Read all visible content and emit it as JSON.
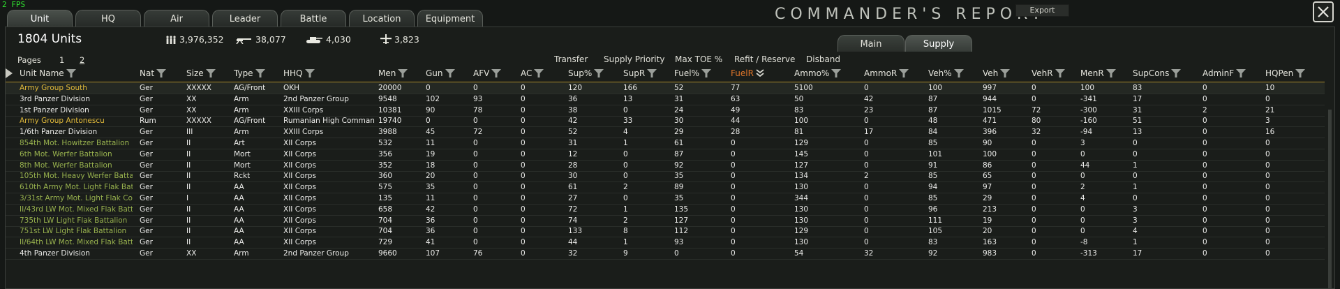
{
  "fps": "2 FPS",
  "tabs": [
    "Unit",
    "HQ",
    "Air",
    "Leader",
    "Battle",
    "Location",
    "Equipment"
  ],
  "title": "COMMANDER'S REPORT",
  "export_label": "Export",
  "units_count": "1804 Units",
  "stats": {
    "men": "3,976,352",
    "guns": "38,077",
    "afv": "4,030",
    "aircraft": "3,823"
  },
  "subtabs": [
    "Main",
    "Supply"
  ],
  "actions": [
    "Transfer",
    "Supply Priority",
    "Max TOE %",
    "Refit / Reserve",
    "Disband"
  ],
  "pages": {
    "label": "Pages",
    "items": [
      "1",
      "2"
    ],
    "current": "2"
  },
  "columns": [
    "Unit Name",
    "Nat",
    "Size",
    "Type",
    "HHQ",
    "Men",
    "Gun",
    "AFV",
    "AC",
    "Sup%",
    "SupR",
    "Fuel%",
    "FuelR",
    "Ammo%",
    "AmmoR",
    "Veh%",
    "Veh",
    "VehR",
    "MenR",
    "SupCons",
    "AdminF",
    "HQPen"
  ],
  "sorted_column": "FuelR",
  "colors": {
    "hq_unit": "#e0b93a",
    "division": "#ececea",
    "support_unit": "#98b24e",
    "accent": "#a88a2a",
    "sorted_header": "#e0762a"
  },
  "rows": [
    {
      "kind": "hq",
      "cells": [
        "Army Group South",
        "Ger",
        "XXXXX",
        "AG/Front",
        "OKH",
        "20000",
        "0",
        "0",
        "0",
        "120",
        "166",
        "52",
        "77",
        "5100",
        "0",
        "100",
        "997",
        "0",
        "100",
        "83",
        "0",
        "10"
      ]
    },
    {
      "kind": "division",
      "cells": [
        "3rd Panzer Division",
        "Ger",
        "XX",
        "Arm",
        "2nd Panzer Group",
        "9548",
        "102",
        "93",
        "0",
        "36",
        "13",
        "31",
        "63",
        "50",
        "42",
        "87",
        "944",
        "0",
        "-341",
        "17",
        "0",
        "0"
      ]
    },
    {
      "kind": "division",
      "cells": [
        "1st Panzer Division",
        "Ger",
        "XX",
        "Arm",
        "XXIII Corps",
        "10381",
        "90",
        "78",
        "0",
        "38",
        "0",
        "24",
        "49",
        "83",
        "23",
        "87",
        "1015",
        "72",
        "-300",
        "31",
        "2",
        "21"
      ]
    },
    {
      "kind": "hq",
      "cells": [
        "Army Group Antonescu",
        "Rum",
        "XXXXX",
        "AG/Front",
        "Rumanian High Comman",
        "19740",
        "0",
        "0",
        "0",
        "42",
        "33",
        "30",
        "44",
        "100",
        "0",
        "48",
        "471",
        "80",
        "-160",
        "51",
        "0",
        "3"
      ]
    },
    {
      "kind": "division",
      "cells": [
        "1/6th Panzer Division",
        "Ger",
        "III",
        "Arm",
        "XXIII Corps",
        "3988",
        "45",
        "72",
        "0",
        "52",
        "4",
        "29",
        "28",
        "81",
        "17",
        "84",
        "396",
        "32",
        "-94",
        "13",
        "0",
        "16"
      ]
    },
    {
      "kind": "support",
      "cells": [
        "854th Mot. Howitzer Battalion",
        "Ger",
        "II",
        "Art",
        "XII Corps",
        "532",
        "11",
        "0",
        "0",
        "31",
        "1",
        "61",
        "0",
        "129",
        "0",
        "85",
        "90",
        "0",
        "3",
        "0",
        "0",
        "0"
      ]
    },
    {
      "kind": "support",
      "cells": [
        "6th Mot. Werfer Battalion",
        "Ger",
        "II",
        "Mort",
        "XII Corps",
        "356",
        "19",
        "0",
        "0",
        "12",
        "0",
        "87",
        "0",
        "145",
        "0",
        "101",
        "100",
        "0",
        "0",
        "0",
        "0",
        "0"
      ]
    },
    {
      "kind": "support",
      "cells": [
        "8th Mot. Werfer Battalion",
        "Ger",
        "II",
        "Mort",
        "XII Corps",
        "352",
        "18",
        "0",
        "0",
        "28",
        "0",
        "92",
        "0",
        "127",
        "0",
        "91",
        "86",
        "0",
        "44",
        "1",
        "0",
        "0"
      ]
    },
    {
      "kind": "support",
      "cells": [
        "105th Mot. Heavy Werfer Battali",
        "Ger",
        "II",
        "Rckt",
        "XII Corps",
        "360",
        "20",
        "0",
        "0",
        "30",
        "0",
        "35",
        "0",
        "134",
        "2",
        "85",
        "65",
        "0",
        "0",
        "0",
        "0",
        "0"
      ]
    },
    {
      "kind": "support",
      "cells": [
        "610th Army Mot. Light Flak Batt",
        "Ger",
        "II",
        "AA",
        "XII Corps",
        "575",
        "35",
        "0",
        "0",
        "61",
        "2",
        "89",
        "0",
        "130",
        "0",
        "94",
        "97",
        "0",
        "2",
        "1",
        "0",
        "0"
      ]
    },
    {
      "kind": "support",
      "cells": [
        "3/31st Army Mot. Light Flak Co",
        "Ger",
        "I",
        "AA",
        "XII Corps",
        "135",
        "11",
        "0",
        "0",
        "27",
        "0",
        "35",
        "0",
        "344",
        "0",
        "85",
        "29",
        "0",
        "4",
        "0",
        "0",
        "0"
      ]
    },
    {
      "kind": "support",
      "cells": [
        "II/43rd LW Mot. Mixed Flak Batt",
        "Ger",
        "II",
        "AA",
        "XII Corps",
        "658",
        "42",
        "0",
        "0",
        "72",
        "1",
        "135",
        "0",
        "130",
        "0",
        "96",
        "213",
        "0",
        "0",
        "3",
        "0",
        "0"
      ]
    },
    {
      "kind": "support",
      "cells": [
        "735th LW Light Flak Battalion",
        "Ger",
        "II",
        "AA",
        "XII Corps",
        "704",
        "36",
        "0",
        "0",
        "74",
        "2",
        "127",
        "0",
        "130",
        "0",
        "111",
        "19",
        "0",
        "0",
        "3",
        "0",
        "0"
      ]
    },
    {
      "kind": "support",
      "cells": [
        "751st LW Light Flak Battalion",
        "Ger",
        "II",
        "AA",
        "XII Corps",
        "704",
        "36",
        "0",
        "0",
        "133",
        "8",
        "112",
        "0",
        "129",
        "0",
        "105",
        "20",
        "0",
        "0",
        "4",
        "0",
        "0"
      ]
    },
    {
      "kind": "support",
      "cells": [
        "II/64th LW Mot. Mixed Flak Batt",
        "Ger",
        "II",
        "AA",
        "XII Corps",
        "729",
        "41",
        "0",
        "0",
        "44",
        "1",
        "93",
        "0",
        "130",
        "0",
        "83",
        "163",
        "0",
        "-8",
        "1",
        "0",
        "0"
      ]
    },
    {
      "kind": "division",
      "cells": [
        "4th Panzer Division",
        "Ger",
        "XX",
        "Arm",
        "2nd Panzer Group",
        "9660",
        "107",
        "76",
        "0",
        "32",
        "9",
        "0",
        "0",
        "54",
        "32",
        "92",
        "983",
        "0",
        "-313",
        "17",
        "0",
        "0"
      ]
    }
  ]
}
